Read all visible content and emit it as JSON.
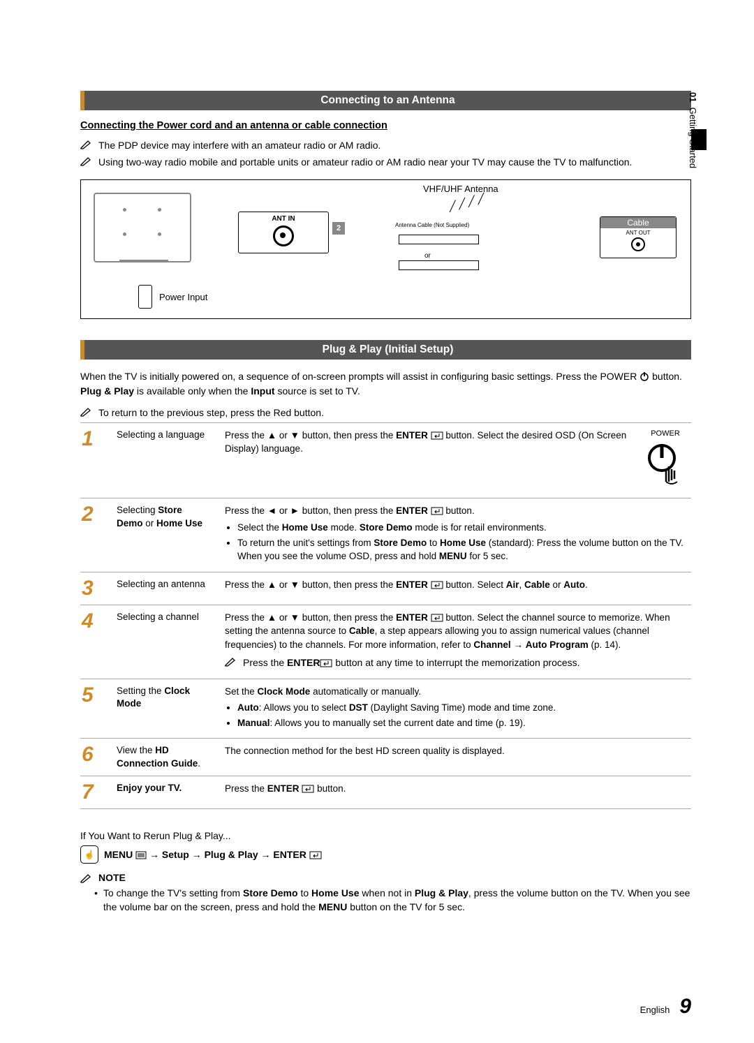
{
  "side_tab": {
    "num": "01",
    "label": "Getting Started"
  },
  "sec1": {
    "title": "Connecting to an Antenna",
    "subhead": "Connecting the Power cord and an antenna or cable connection",
    "note1": "The PDP device may interfere with an amateur radio or AM radio.",
    "note2": "Using two-way radio mobile and portable units or amateur radio or AM radio near your TV may cause the TV to malfunction."
  },
  "diagram": {
    "ant_in": "ANT IN",
    "vhf": "VHF/UHF Antenna",
    "cable_txt": "Antenna Cable (Not Supplied)",
    "or": "or",
    "cable": "Cable",
    "ant_out": "ANT OUT",
    "power": "Power Input",
    "num2": "2"
  },
  "sec2": {
    "title": "Plug & Play (Initial Setup)",
    "intro_a": "When the TV is initially powered on, a sequence of on-screen prompts will assist in configuring basic settings. Press the POWER",
    "intro_b": " button. ",
    "intro_c": "Plug & Play",
    "intro_d": " is available only when the ",
    "intro_e": "Input",
    "intro_f": " source is set to TV.",
    "return_note": "To return to the previous step, press the Red button.",
    "power_label": "POWER"
  },
  "steps": [
    {
      "n": "1",
      "title": "Selecting a language",
      "body_a": "Press the ▲ or ▼ button, then press the ",
      "body_b": "ENTER",
      "body_c": " button. Select the desired OSD (On Screen Display) language."
    },
    {
      "n": "2",
      "title_a": "Selecting ",
      "title_b": "Store Demo",
      "title_c": " or ",
      "title_d": "Home Use",
      "body_a": "Press the ◄ or ► button, then press the ",
      "body_b": "ENTER",
      "body_c": " button.",
      "li1_a": "Select the ",
      "li1_b": "Home Use",
      "li1_c": " mode. ",
      "li1_d": "Store Demo",
      "li1_e": " mode is for retail environments.",
      "li2_a": "To return the unit's settings from ",
      "li2_b": "Store Demo",
      "li2_c": " to ",
      "li2_d": "Home Use",
      "li2_e": " (standard): Press the volume button on the TV. When you see the volume OSD, press and hold ",
      "li2_f": "MENU",
      "li2_g": " for 5 sec."
    },
    {
      "n": "3",
      "title": "Selecting an antenna",
      "body_a": "Press the ▲ or ▼ button, then press the ",
      "body_b": "ENTER",
      "body_c": " button. Select ",
      "body_d": "Air",
      "body_e": ", ",
      "body_f": "Cable",
      "body_g": " or ",
      "body_h": "Auto",
      "body_i": "."
    },
    {
      "n": "4",
      "title": "Selecting a channel",
      "body_a": "Press the ▲ or ▼ button, then press the ",
      "body_b": "ENTER",
      "body_c": " button. Select the channel source to memorize. When setting the antenna source to ",
      "body_d": "Cable",
      "body_e": ", a step appears allowing you to assign numerical values (channel frequencies) to the channels. For more information, refer to ",
      "body_f": "Channel",
      "body_g": " → ",
      "body_h": "Auto Program",
      "body_i": " (p. 14).",
      "sub_a": "Press the ",
      "sub_b": "ENTER",
      "sub_c": " button at any time to interrupt the memorization process."
    },
    {
      "n": "5",
      "title_a": "Setting the ",
      "title_b": "Clock Mode",
      "body_a": "Set the ",
      "body_b": "Clock Mode",
      "body_c": " automatically or manually.",
      "li1_a": "Auto",
      "li1_b": ": Allows you to select ",
      "li1_c": "DST",
      "li1_d": " (Daylight Saving Time) mode and time zone.",
      "li2_a": "Manual",
      "li2_b": ": Allows you to manually set the current date and time (p. 19)."
    },
    {
      "n": "6",
      "title_a": "View the ",
      "title_b": "HD Connection Guide",
      "title_c": ".",
      "body": "The connection method for the best HD screen quality is displayed."
    },
    {
      "n": "7",
      "title": "Enjoy your TV.",
      "body_a": "Press the ",
      "body_b": "ENTER",
      "body_c": " button."
    }
  ],
  "rerun": {
    "heading": "If You Want to Rerun Plug & Play...",
    "menu": "MENU",
    "path_a": " → ",
    "path_b": "Setup",
    "path_c": " → ",
    "path_d": "Plug & Play",
    "path_e": " → ",
    "path_f": "ENTER"
  },
  "note": {
    "head": "NOTE",
    "bullet_a": "To change the TV's setting from ",
    "bullet_b": "Store Demo",
    "bullet_c": " to ",
    "bullet_d": "Home Use",
    "bullet_e": " when not in ",
    "bullet_f": "Plug & Play",
    "bullet_g": ", press the volume button on the TV. When you see the volume bar on the screen, press and hold the ",
    "bullet_h": "MENU",
    "bullet_i": " button on the TV for 5 sec."
  },
  "footer": {
    "lang": "English",
    "page": "9"
  }
}
